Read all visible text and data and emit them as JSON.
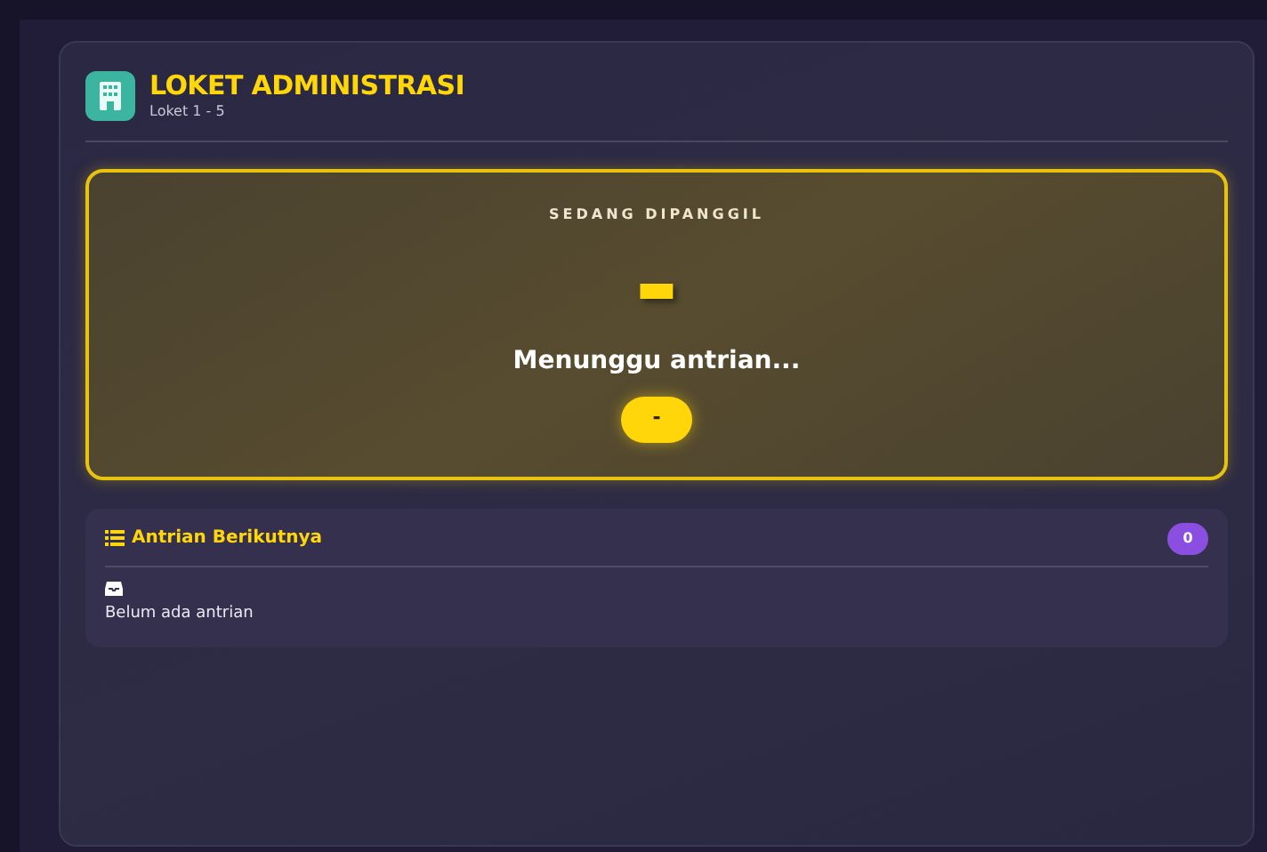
{
  "header": {
    "title": "LOKET ADMINISTRASI",
    "subtitle": "Loket 1 - 5"
  },
  "current_call": {
    "label": "SEDANG DIPANGGIL",
    "number": "-",
    "status": "Menunggu antrian...",
    "counter": "-"
  },
  "next_queue": {
    "title": "Antrian Berikutnya",
    "count": "0",
    "empty_message": "Belum ada antrian"
  }
}
